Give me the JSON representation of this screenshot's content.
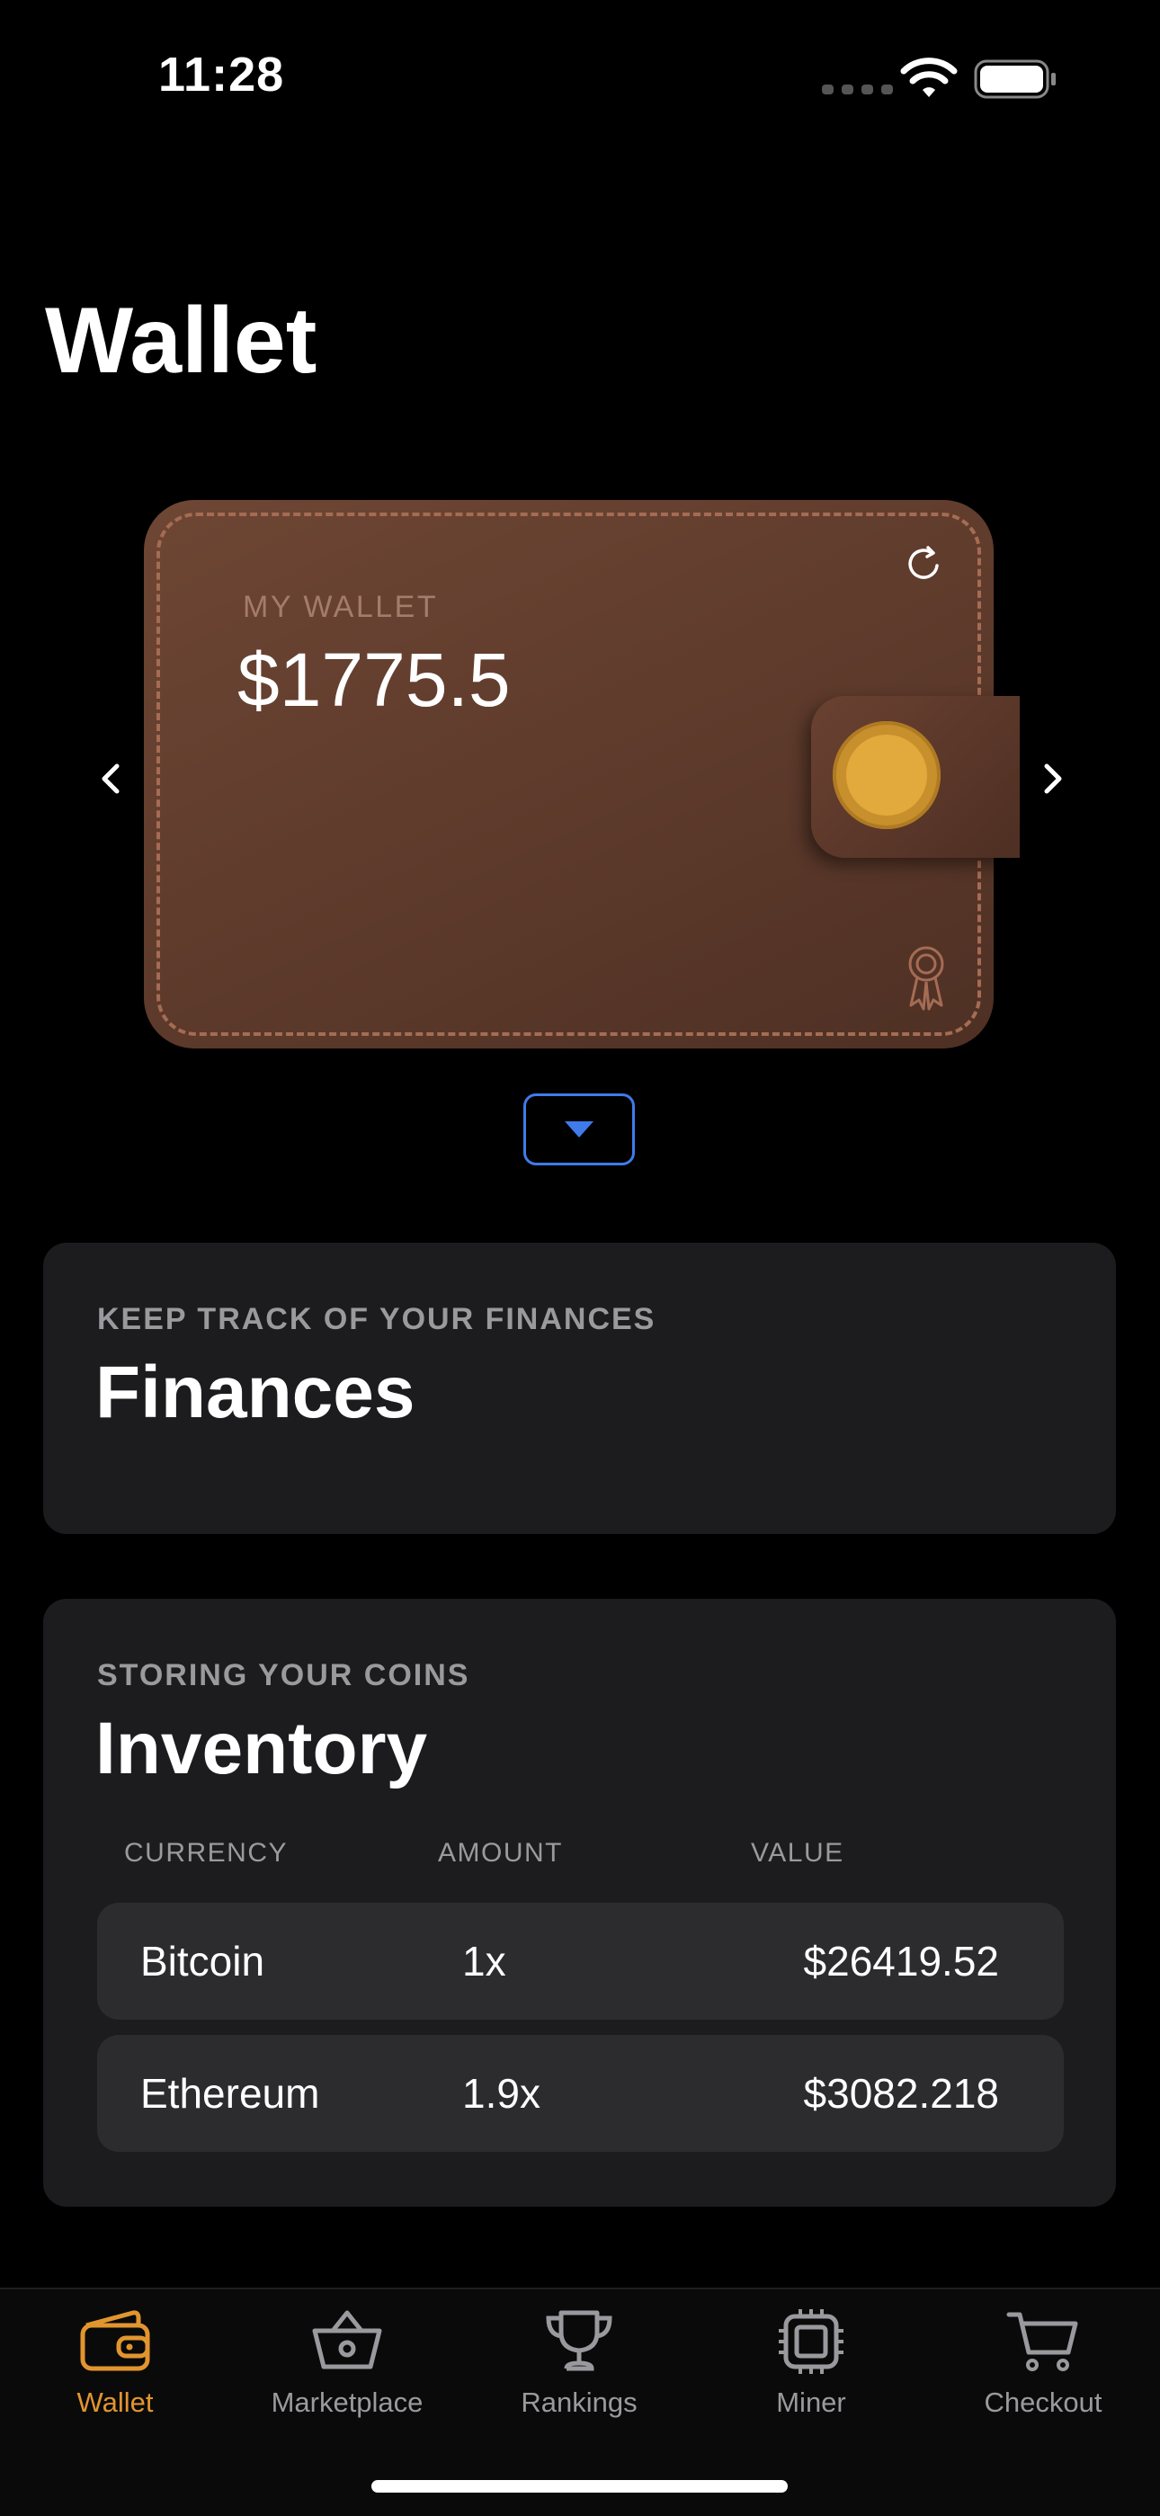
{
  "status_bar": {
    "time": "11:28"
  },
  "page_title": "Wallet",
  "wallet_card": {
    "label": "MY WALLET",
    "balance": "$1775.5",
    "icons": [
      "refresh-icon",
      "award-ribbon-icon",
      "coin-icon",
      "chevron-left-icon",
      "chevron-right-icon",
      "caret-down-icon"
    ]
  },
  "finances": {
    "eyebrow": "KEEP TRACK OF YOUR FINANCES",
    "title": "Finances"
  },
  "inventory": {
    "eyebrow": "STORING YOUR COINS",
    "title": "Inventory",
    "columns": [
      "CURRENCY",
      "AMOUNT",
      "VALUE"
    ],
    "rows": [
      {
        "currency": "Bitcoin",
        "amount": "1x",
        "value": "$26419.52"
      },
      {
        "currency": "Ethereum",
        "amount": "1.9x",
        "value": "$3082.218"
      }
    ]
  },
  "tabs": [
    {
      "label": "Wallet",
      "icon": "wallet-icon",
      "active": true
    },
    {
      "label": "Marketplace",
      "icon": "basket-icon",
      "active": false
    },
    {
      "label": "Rankings",
      "icon": "trophy-icon",
      "active": false
    },
    {
      "label": "Miner",
      "icon": "cpu-icon",
      "active": false
    },
    {
      "label": "Checkout",
      "icon": "cart-icon",
      "active": false
    }
  ],
  "colors": {
    "accent": "#e2952f",
    "tab_inactive": "#9a9a9e",
    "card_bg": "#1c1c1e",
    "row_bg": "#2c2c2e",
    "wallet_leather": "#5d3a2b",
    "expand_border": "#3f7bea"
  }
}
